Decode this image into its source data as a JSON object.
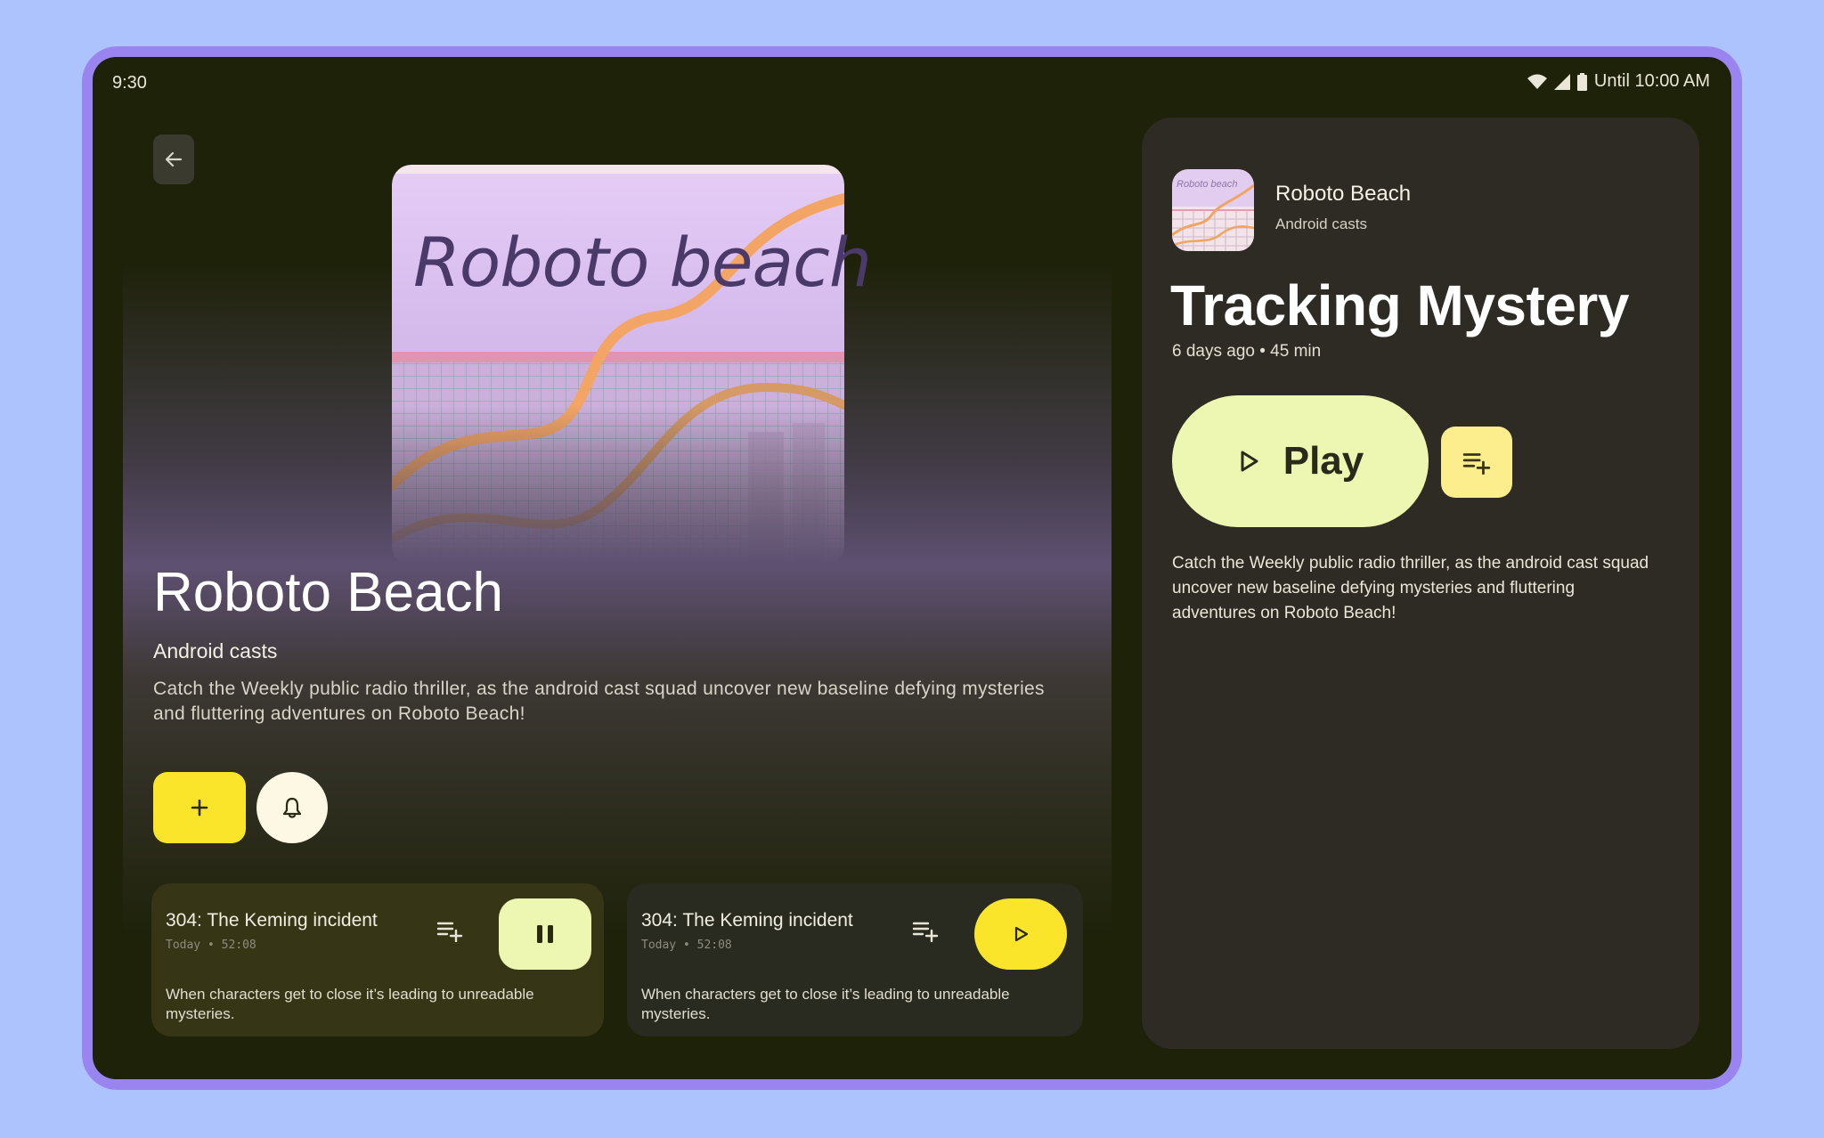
{
  "status_bar": {
    "time": "9:30",
    "battery_label": "Until 10:00 AM"
  },
  "podcast": {
    "artwork_text": "Roboto beach",
    "title": "Roboto Beach",
    "author": "Android casts",
    "description": "Catch the Weekly public radio thriller, as the android cast squad uncover new baseline defying mysteries and fluttering adventures on Roboto Beach!"
  },
  "episodes": [
    {
      "title": "304: The Keming incident",
      "meta": "Today • 52:08",
      "description": "When characters get to close it’s leading to unreadable mysteries.",
      "state": "playing"
    },
    {
      "title": "304: The Keming incident",
      "meta": "Today • 52:08",
      "description": "When characters get to close it’s leading to unreadable mysteries.",
      "state": "paused"
    }
  ],
  "detail": {
    "thumb_text": "Roboto beach",
    "podcast": "Roboto Beach",
    "author": "Android casts",
    "title": "Tracking Mystery",
    "meta": "6 days ago • 45 min",
    "play_label": "Play",
    "description": "Catch the Weekly public radio thriller, as the android cast squad uncover new baseline defying mysteries and fluttering adventures on Roboto Beach!"
  },
  "icons": {
    "back": "arrow-back-icon",
    "add": "plus-icon",
    "notify": "bell-icon",
    "queue": "playlist-add-icon",
    "pause": "pause-icon",
    "play": "play-icon"
  },
  "colors": {
    "background": "#1e2209",
    "accent_yellow": "#fbe52a",
    "accent_lime": "#eef7b2",
    "pane": "#2e2a24",
    "frame": "#9a85f0",
    "outer": "#adc3fd"
  }
}
